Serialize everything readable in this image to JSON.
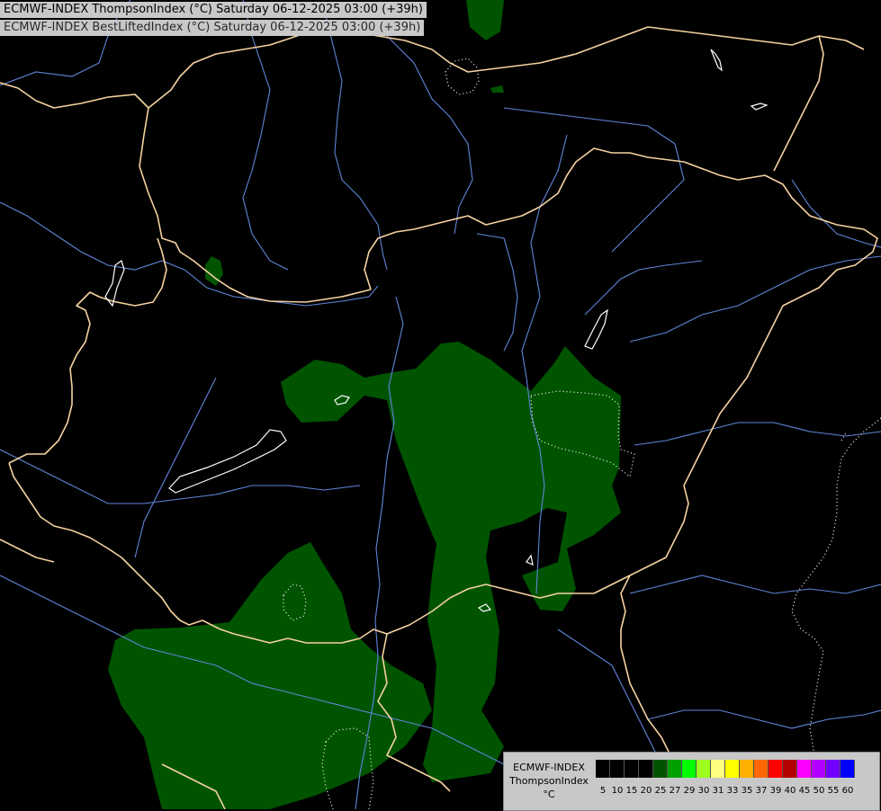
{
  "map": {
    "title_line1": "ECMWF-INDEX ThompsonIndex (°C) Saturday 06-12-2025 03:00 (+39h)",
    "title_line2": "ECMWF-INDEX BestLiftedIndex (°C) Saturday 06-12-2025 03:00 (+39h)",
    "colors": {
      "background": "#000000",
      "border": "#f5d2a0",
      "river": "#5f86d8",
      "zone_fill": "#005400"
    }
  },
  "legend": {
    "line1": "ECMWF-INDEX",
    "line2": "ThompsonIndex",
    "line3": "°C",
    "scale": [
      {
        "value": "5",
        "color": "#000000"
      },
      {
        "value": "10",
        "color": "#000000"
      },
      {
        "value": "15",
        "color": "#000000"
      },
      {
        "value": "20",
        "color": "#000000"
      },
      {
        "value": "25",
        "color": "#005400"
      },
      {
        "value": "27",
        "color": "#00a000"
      },
      {
        "value": "29",
        "color": "#00ff00"
      },
      {
        "value": "30",
        "color": "#9cff20"
      },
      {
        "value": "31",
        "color": "#ffff80"
      },
      {
        "value": "33",
        "color": "#ffff00"
      },
      {
        "value": "35",
        "color": "#ffb000"
      },
      {
        "value": "37",
        "color": "#ff6800"
      },
      {
        "value": "39",
        "color": "#ff0000"
      },
      {
        "value": "40",
        "color": "#b40000"
      },
      {
        "value": "45",
        "color": "#ff00ff"
      },
      {
        "value": "50",
        "color": "#b400ff"
      },
      {
        "value": "55",
        "color": "#7000ff"
      },
      {
        "value": "60",
        "color": "#0000ff"
      }
    ]
  }
}
